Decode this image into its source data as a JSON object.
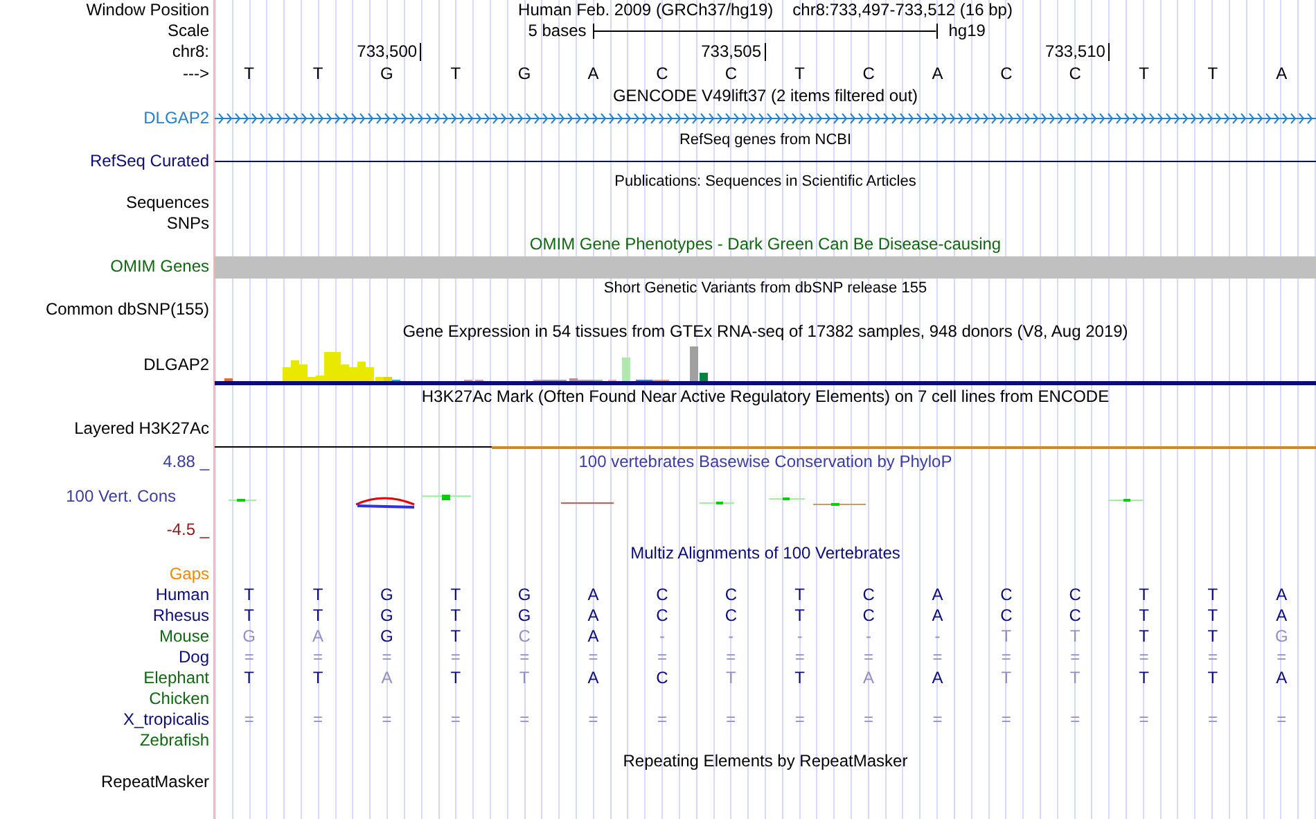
{
  "window_position": {
    "label": "Window Position",
    "assembly": "Human Feb. 2009 (GRCh37/hg19)",
    "position": "chr8:733,497-733,512 (16 bp)"
  },
  "scale": {
    "label": "Scale",
    "span": "5 bases",
    "assembly": "hg19"
  },
  "ruler": {
    "label": "chr8:",
    "positions": [
      "733,500",
      "733,505",
      "733,510"
    ]
  },
  "sequence": {
    "label": "--->",
    "bases": [
      "T",
      "T",
      "G",
      "T",
      "G",
      "A",
      "C",
      "C",
      "T",
      "C",
      "A",
      "C",
      "C",
      "T",
      "T",
      "A"
    ]
  },
  "tracks": [
    {
      "kind": "gene",
      "title": "GENCODE V49lift37 (2 items filtered out)",
      "label": "DLGAP2",
      "color": "#2a7fc4"
    },
    {
      "kind": "line",
      "title": "RefSeq genes from NCBI",
      "label": "RefSeq Curated",
      "color": "#0c0c78"
    },
    {
      "kind": "empty",
      "title": "Publications: Sequences in Scientific Articles",
      "labels": [
        "Sequences",
        "SNPs"
      ]
    },
    {
      "kind": "bar",
      "title": "OMIM Gene Phenotypes - Dark Green Can Be Disease-causing",
      "label": "OMIM Genes",
      "color": "#116611"
    },
    {
      "kind": "empty",
      "title": "Short Genetic Variants from dbSNP release 155",
      "label": "Common dbSNP(155)"
    },
    {
      "kind": "barchart",
      "title": "Gene Expression in 54 tissues from GTEx RNA-seq of 17382 samples, 948 donors (V8, Aug 2019)",
      "label": "DLGAP2"
    },
    {
      "kind": "layered",
      "title": "H3K27Ac Mark (Often Found Near Active Regulatory Elements) on 7 cell lines from ENCODE",
      "label": "Layered H3K27Ac"
    },
    {
      "kind": "wiggle",
      "title": "100 vertebrates Basewise Conservation by PhyloP",
      "label": "100 Vert. Cons",
      "max": "4.88 _",
      "min": "-4.5 _",
      "color": "#3c3ca0"
    },
    {
      "kind": "alignment",
      "title": "Multiz Alignments of 100 Vertebrates",
      "label": "Gaps",
      "color": "#e88a10",
      "species": [
        {
          "name": "Human",
          "color": "#0c0c78",
          "bases": [
            {
              "text": "T",
              "faded": false
            },
            {
              "text": "T",
              "faded": false
            },
            {
              "text": "G",
              "faded": false
            },
            {
              "text": "T",
              "faded": false
            },
            {
              "text": "G",
              "faded": false
            },
            {
              "text": "A",
              "faded": false
            },
            {
              "text": "C",
              "faded": false
            },
            {
              "text": "C",
              "faded": false
            },
            {
              "text": "T",
              "faded": false
            },
            {
              "text": "C",
              "faded": false
            },
            {
              "text": "A",
              "faded": false
            },
            {
              "text": "C",
              "faded": false
            },
            {
              "text": "C",
              "faded": false
            },
            {
              "text": "T",
              "faded": false
            },
            {
              "text": "T",
              "faded": false
            },
            {
              "text": "A",
              "faded": false
            }
          ]
        },
        {
          "name": "Rhesus",
          "color": "#0c0c78",
          "bases": [
            {
              "text": "T",
              "faded": false
            },
            {
              "text": "T",
              "faded": false
            },
            {
              "text": "G",
              "faded": false
            },
            {
              "text": "T",
              "faded": false
            },
            {
              "text": "G",
              "faded": false
            },
            {
              "text": "A",
              "faded": false
            },
            {
              "text": "C",
              "faded": false
            },
            {
              "text": "C",
              "faded": false
            },
            {
              "text": "T",
              "faded": false
            },
            {
              "text": "C",
              "faded": false
            },
            {
              "text": "A",
              "faded": false
            },
            {
              "text": "C",
              "faded": false
            },
            {
              "text": "C",
              "faded": false
            },
            {
              "text": "T",
              "faded": false
            },
            {
              "text": "T",
              "faded": false
            },
            {
              "text": "A",
              "faded": false
            }
          ]
        },
        {
          "name": "Mouse",
          "color": "#116611",
          "bases": [
            {
              "text": "G",
              "faded": true
            },
            {
              "text": "A",
              "faded": true
            },
            {
              "text": "G",
              "faded": false
            },
            {
              "text": "T",
              "faded": false
            },
            {
              "text": "C",
              "faded": true
            },
            {
              "text": "A",
              "faded": false
            },
            {
              "text": "-",
              "faded": true
            },
            {
              "text": "-",
              "faded": true
            },
            {
              "text": "-",
              "faded": true
            },
            {
              "text": "-",
              "faded": true
            },
            {
              "text": "-",
              "faded": true
            },
            {
              "text": "T",
              "faded": true
            },
            {
              "text": "T",
              "faded": true
            },
            {
              "text": "T",
              "faded": false
            },
            {
              "text": "T",
              "faded": false
            },
            {
              "text": "G",
              "faded": true
            }
          ]
        },
        {
          "name": "Dog",
          "color": "#0c0c78",
          "bases": [
            {
              "text": "=",
              "faded": true
            },
            {
              "text": "=",
              "faded": true
            },
            {
              "text": "=",
              "faded": true
            },
            {
              "text": "=",
              "faded": true
            },
            {
              "text": "=",
              "faded": true
            },
            {
              "text": "=",
              "faded": true
            },
            {
              "text": "=",
              "faded": true
            },
            {
              "text": "=",
              "faded": true
            },
            {
              "text": "=",
              "faded": true
            },
            {
              "text": "=",
              "faded": true
            },
            {
              "text": "=",
              "faded": true
            },
            {
              "text": "=",
              "faded": true
            },
            {
              "text": "=",
              "faded": true
            },
            {
              "text": "=",
              "faded": true
            },
            {
              "text": "=",
              "faded": true
            },
            {
              "text": "=",
              "faded": true
            }
          ]
        },
        {
          "name": "Elephant",
          "color": "#116611",
          "bases": [
            {
              "text": "T",
              "faded": false
            },
            {
              "text": "T",
              "faded": false
            },
            {
              "text": "A",
              "faded": true
            },
            {
              "text": "T",
              "faded": false
            },
            {
              "text": "T",
              "faded": true
            },
            {
              "text": "A",
              "faded": false
            },
            {
              "text": "C",
              "faded": false
            },
            {
              "text": "T",
              "faded": true
            },
            {
              "text": "T",
              "faded": false
            },
            {
              "text": "A",
              "faded": true
            },
            {
              "text": "A",
              "faded": false
            },
            {
              "text": "T",
              "faded": true
            },
            {
              "text": "T",
              "faded": true
            },
            {
              "text": "T",
              "faded": false
            },
            {
              "text": "T",
              "faded": false
            },
            {
              "text": "A",
              "faded": false
            }
          ]
        },
        {
          "name": "Chicken",
          "color": "#116611"
        },
        {
          "name": "X_tropicalis",
          "color": "#0c0c78",
          "bases": [
            {
              "text": "=",
              "faded": true
            },
            {
              "text": "=",
              "faded": true
            },
            {
              "text": "=",
              "faded": true
            },
            {
              "text": "=",
              "faded": true
            },
            {
              "text": "=",
              "faded": true
            },
            {
              "text": "=",
              "faded": true
            },
            {
              "text": "=",
              "faded": true
            },
            {
              "text": "=",
              "faded": true
            },
            {
              "text": "=",
              "faded": true
            },
            {
              "text": "=",
              "faded": true
            },
            {
              "text": "=",
              "faded": true
            },
            {
              "text": "=",
              "faded": true
            },
            {
              "text": "=",
              "faded": true
            },
            {
              "text": "=",
              "faded": true
            },
            {
              "text": "=",
              "faded": true
            },
            {
              "text": "=",
              "faded": true
            }
          ]
        },
        {
          "name": "Zebrafish",
          "color": "#116611"
        }
      ]
    },
    {
      "kind": "empty",
      "title": "Repeating Elements by RepeatMasker",
      "label": "RepeatMasker"
    }
  ]
}
